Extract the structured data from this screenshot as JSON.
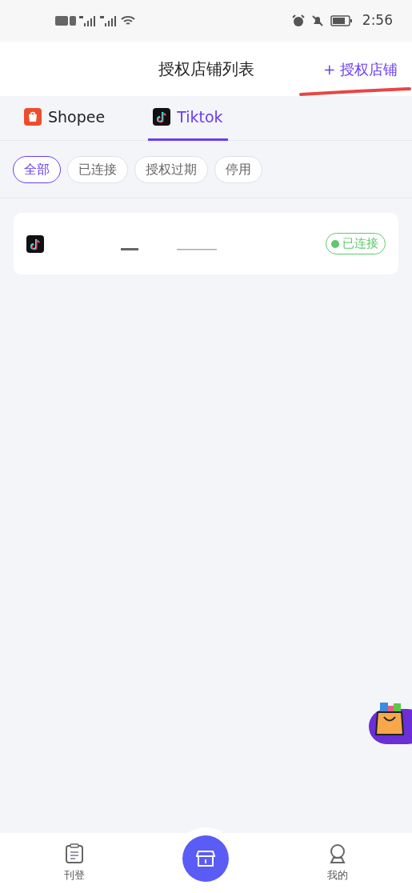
{
  "status_bar": {
    "time": "2:56"
  },
  "header": {
    "title": "授权店铺列表",
    "action": "+ 授权店铺"
  },
  "platform_tabs": [
    {
      "label": "Shopee",
      "kind": "shopee",
      "selected": false
    },
    {
      "label": "Tiktok",
      "kind": "tiktok",
      "selected": true
    }
  ],
  "filters": [
    {
      "label": "全部",
      "selected": true
    },
    {
      "label": "已连接",
      "selected": false
    },
    {
      "label": "授权过期",
      "selected": false
    },
    {
      "label": "停用",
      "selected": false
    }
  ],
  "stores": [
    {
      "kind": "tiktok",
      "status": "已连接",
      "connected": true
    }
  ],
  "bottom_nav": [
    {
      "label": "刊登",
      "kind": "listing"
    },
    {
      "kind": "store"
    },
    {
      "label": "我的",
      "kind": "profile"
    }
  ]
}
